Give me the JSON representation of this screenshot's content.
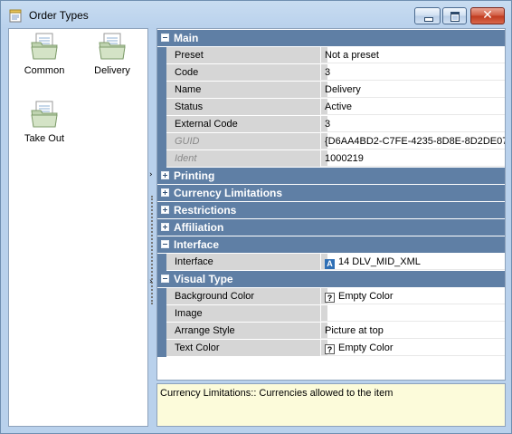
{
  "window": {
    "title": "Order Types",
    "icon": "notepad-icon",
    "controls": {
      "minimize": "minimize-icon",
      "maximize": "maximize-icon",
      "close": "close-icon"
    }
  },
  "types": [
    {
      "label": "Common",
      "icon": "folder-document-icon"
    },
    {
      "label": "Delivery",
      "icon": "folder-document-icon"
    },
    {
      "label": "Take Out",
      "icon": "folder-document-icon"
    }
  ],
  "categories": {
    "main": "Main",
    "printing": "Printing",
    "currency_limitations": "Currency Limitations",
    "restrictions": "Restrictions",
    "affiliation": "Affiliation",
    "interface": "Interface",
    "visual_type": "Visual Type"
  },
  "main_props": [
    {
      "name": "Preset",
      "value": "Not a preset"
    },
    {
      "name": "Code",
      "value": "3"
    },
    {
      "name": "Name",
      "value": "Delivery"
    },
    {
      "name": "Status",
      "value": "Active"
    },
    {
      "name": "External Code",
      "value": "3"
    },
    {
      "name": "GUID",
      "value": "{D6AA4BD2-C7FE-4235-8D8E-8D2DE07!"
    },
    {
      "name": "Ident",
      "value": "1000219"
    }
  ],
  "interface_props": [
    {
      "name": "Interface",
      "value": "14 DLV_MID_XML"
    }
  ],
  "visual_props": [
    {
      "name": "Background Color",
      "value": "Empty Color"
    },
    {
      "name": "Image",
      "value": ""
    },
    {
      "name": "Arrange Style",
      "value": "Picture at top"
    },
    {
      "name": "Text Color",
      "value": "Empty Color"
    }
  ],
  "glyphs": {
    "expanded": "−",
    "collapsed": "+",
    "unknown": "?",
    "interface_badge": "A",
    "splitter_arrow": "›"
  },
  "description": "Currency Limitations:: Currencies allowed to the item",
  "colors": {
    "category_bg": "#5f7fa5",
    "name_cell_bg": "#d6d6d6",
    "description_bg": "#fcfbda"
  }
}
